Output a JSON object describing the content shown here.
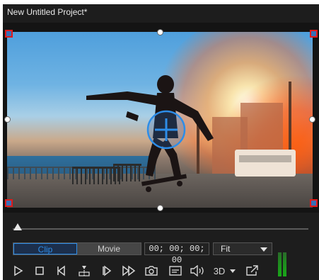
{
  "window": {
    "title": "New Untitled Project*"
  },
  "preview": {
    "image_name": "skateboarder-at-sunset",
    "crop_handles": [
      "top-left",
      "top-right",
      "bottom-left",
      "bottom-right"
    ]
  },
  "playback": {
    "mode_tabs": [
      {
        "label": "Clip",
        "active": true
      },
      {
        "label": "Movie",
        "active": false
      }
    ],
    "timecode": "00; 00; 00; 00",
    "zoom": {
      "selected": "Fit"
    },
    "stereo_label": "3D",
    "scrub_position": 0.0
  },
  "icons": [
    "play-icon",
    "stop-icon",
    "previous-frame-icon",
    "split-icon",
    "next-frame-icon",
    "fast-forward-icon",
    "snapshot-icon",
    "subtitle-icon",
    "volume-icon",
    "3d-dropdown-icon",
    "external-display-icon"
  ],
  "colors": {
    "accent": "#2d8de8",
    "crop_handle_border": "#e01a1a",
    "background": "#1d1d1d"
  }
}
